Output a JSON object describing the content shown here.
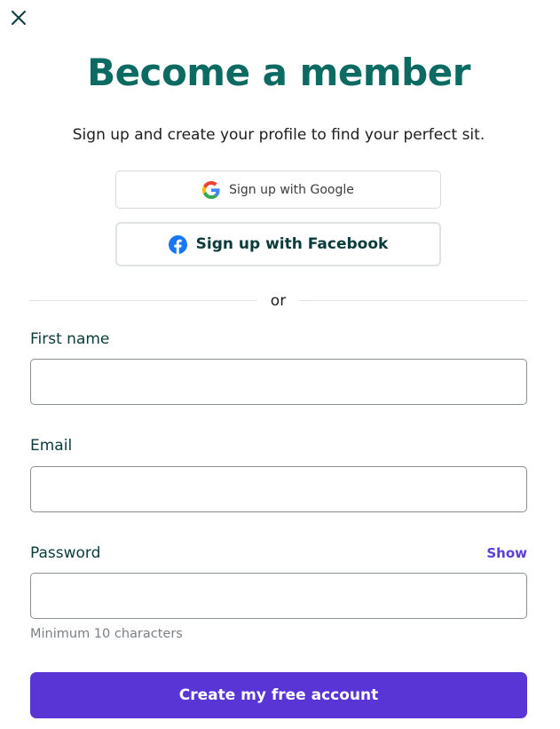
{
  "close_icon": "close-icon",
  "header": {
    "title": "Become a member",
    "subtitle": "Sign up and create your profile to find your perfect sit."
  },
  "social": {
    "google_label": "Sign up with Google",
    "google_icon": "google-icon",
    "facebook_label": "Sign up with Facebook",
    "facebook_icon": "facebook-icon"
  },
  "divider_text": "or",
  "form": {
    "first_name": {
      "label": "First name",
      "value": "",
      "placeholder": ""
    },
    "email": {
      "label": "Email",
      "value": "",
      "placeholder": ""
    },
    "password": {
      "label": "Password",
      "value": "",
      "placeholder": "",
      "show_label": "Show",
      "hint": "Minimum 10 characters"
    },
    "submit_label": "Create my free account"
  },
  "colors": {
    "title": "#0b6b63",
    "accent": "#5a35d6",
    "label": "#0a3b3a",
    "facebook_blue": "#1877f2"
  }
}
